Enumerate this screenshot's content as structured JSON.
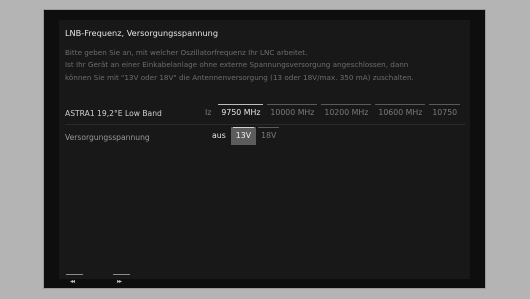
{
  "dialog": {
    "title": "LNB-Frequenz, Versorgungsspannung",
    "description_lines": [
      "Bitte geben Sie an, mit welcher Oszillatorfrequenz Ihr LNC arbeitet.",
      "Ist Ihr Gerät an einer Einkabelanlage ohne externe Spannungsversorgung angeschlossen, dann",
      "können Sie mit \"13V oder 18V\" die Antennenversorgung (13 oder 18V/max. 350 mA) zuschalten."
    ]
  },
  "rows": {
    "lnb": {
      "label": "ASTRA1 19,2°E Low Band",
      "options": [
        "Iz",
        "9750 MHz",
        "10000 MHz",
        "10200 MHz",
        "10600 MHz",
        "10750"
      ],
      "selected": "9750 MHz"
    },
    "voltage": {
      "label": "Versorgungsspannung",
      "options": [
        "aus",
        "13V",
        "18V"
      ],
      "selected": "13V"
    }
  },
  "footer": {
    "rewind_icon": "rewind-icon",
    "rewind_glyph": "◂◂",
    "forward_icon": "fast-forward-icon",
    "forward_glyph": "▸▸"
  },
  "colors": {
    "background": "#b4b4b4",
    "screen": "#0e0e0e",
    "panel": "#181818",
    "selected_option": "#5c5c5c"
  }
}
